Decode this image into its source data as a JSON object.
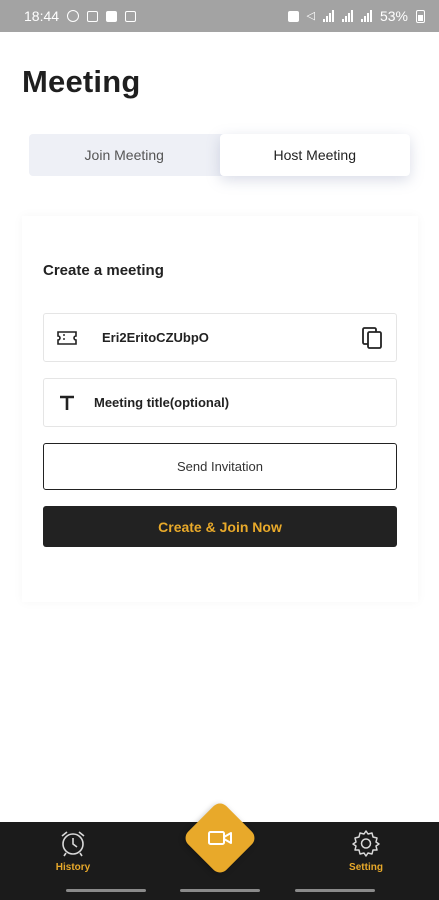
{
  "status_bar": {
    "time": "18:44",
    "battery": "53%",
    "signal": "|||"
  },
  "page": {
    "title": "Meeting"
  },
  "tabs": [
    {
      "label": "Join Meeting",
      "active": false
    },
    {
      "label": "Host Meeting",
      "active": true
    }
  ],
  "card": {
    "title": "Create a meeting",
    "meeting_code": "Eri2EritoCZUbpO",
    "meeting_title_placeholder": "Meeting title(optional)",
    "send_invitation_label": "Send Invitation",
    "create_join_label": "Create & Join Now"
  },
  "bottom_nav": {
    "history_label": "History",
    "setting_label": "Setting",
    "accent_color": "#e8a92a"
  }
}
